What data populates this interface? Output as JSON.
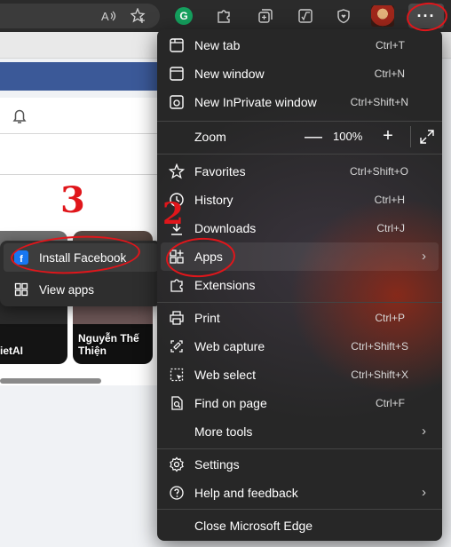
{
  "toolbar": {
    "read_aloud_icon": "read-aloud-icon",
    "favorites_add_icon": "add-favorite-icon",
    "grammarly_glyph": "G",
    "extensions_icon": "puzzle-icon",
    "collections_icon": "collections-icon",
    "math_solver_icon": "math-solver-icon",
    "browser_essentials_icon": "heart-shield-icon",
    "menu_glyph": "···"
  },
  "page": {
    "stories": [
      {
        "name": "ietAI"
      },
      {
        "name": "Nguyễn Thế Thiện"
      }
    ]
  },
  "apps_submenu": {
    "items": [
      {
        "label": "Install Facebook",
        "icon": "facebook-app-icon"
      },
      {
        "label": "View apps",
        "icon": "apps-grid-icon"
      }
    ]
  },
  "menu": {
    "items": [
      {
        "label": "New tab",
        "shortcut": "Ctrl+T",
        "icon": "new-tab-icon"
      },
      {
        "label": "New window",
        "shortcut": "Ctrl+N",
        "icon": "window-icon"
      },
      {
        "label": "New InPrivate window",
        "shortcut": "Ctrl+Shift+N",
        "icon": "inprivate-icon"
      },
      {
        "label": "Favorites",
        "shortcut": "Ctrl+Shift+O",
        "icon": "star-icon"
      },
      {
        "label": "History",
        "shortcut": "Ctrl+H",
        "icon": "history-icon"
      },
      {
        "label": "Downloads",
        "shortcut": "Ctrl+J",
        "icon": "download-icon"
      },
      {
        "label": "Apps",
        "shortcut": "",
        "icon": "apps-icon"
      },
      {
        "label": "Extensions",
        "shortcut": "",
        "icon": "puzzle-icon"
      },
      {
        "label": "Print",
        "shortcut": "Ctrl+P",
        "icon": "print-icon"
      },
      {
        "label": "Web capture",
        "shortcut": "Ctrl+Shift+S",
        "icon": "web-capture-icon"
      },
      {
        "label": "Web select",
        "shortcut": "Ctrl+Shift+X",
        "icon": "web-select-icon"
      },
      {
        "label": "Find on page",
        "shortcut": "Ctrl+F",
        "icon": "find-icon"
      },
      {
        "label": "More tools",
        "shortcut": "",
        "icon": ""
      },
      {
        "label": "Settings",
        "shortcut": "",
        "icon": "gear-icon"
      },
      {
        "label": "Help and feedback",
        "shortcut": "",
        "icon": "help-icon"
      },
      {
        "label": "Close Microsoft Edge",
        "shortcut": "",
        "icon": ""
      }
    ],
    "zoom": {
      "label": "Zoom",
      "minus": "—",
      "value": "100%",
      "plus": "+"
    }
  },
  "annotations": {
    "step_2": "2",
    "step_3": "3",
    "color": "#e0161b"
  }
}
